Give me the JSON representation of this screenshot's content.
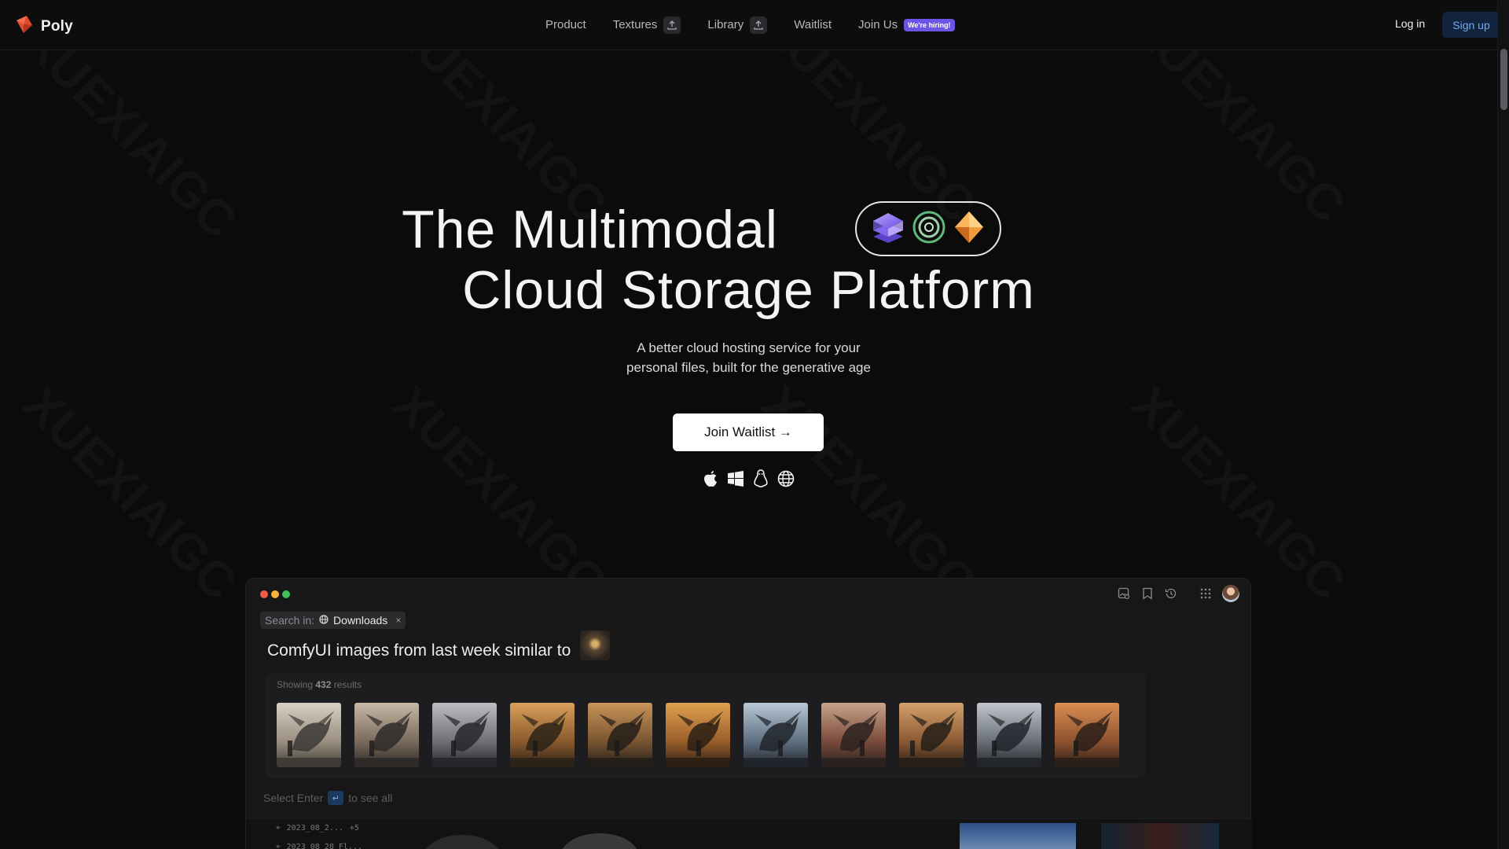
{
  "brand": {
    "name": "Poly",
    "accent": "#e04a2f"
  },
  "nav": {
    "items": [
      {
        "label": "Product"
      },
      {
        "label": "Textures",
        "icon": "upload-icon"
      },
      {
        "label": "Library",
        "icon": "upload-icon"
      },
      {
        "label": "Waitlist"
      },
      {
        "label": "Join Us",
        "badge": "We're hiring!"
      }
    ],
    "login": "Log in",
    "signup": "Sign up"
  },
  "hero": {
    "line1": "The Multimodal",
    "line2": "Cloud Storage Platform",
    "pill_icons": [
      "layers-icon",
      "rings-icon",
      "diamond-icon"
    ],
    "subtitle_line1": "A better cloud hosting service for your",
    "subtitle_line2": "personal files, built for the generative age",
    "cta": "Join Waitlist →",
    "platforms": [
      "apple-icon",
      "windows-icon",
      "linux-icon",
      "globe-icon"
    ]
  },
  "app": {
    "traffic_colors": [
      "#f05a4a",
      "#f4b43c",
      "#3fbf57"
    ],
    "tools": [
      "image-search-icon",
      "bookmark-icon",
      "history-icon",
      "grid-icon"
    ],
    "scope_prefix": "Search in:",
    "scope_value": "Downloads",
    "scope_close": "×",
    "query": "ComfyUI images from last week similar to",
    "results_prefix": "Showing",
    "results_count": "432",
    "results_suffix": "results",
    "result_count_thumbs": 11,
    "hint_before": "Select Enter",
    "hint_key": "↵",
    "hint_after": "to see all",
    "files": [
      {
        "name": "2023_08_2...",
        "extra": "+5"
      },
      {
        "name": "2023_08_28_Fl...",
        "extra": ""
      }
    ]
  },
  "watermark": "XUEXIAIGC"
}
